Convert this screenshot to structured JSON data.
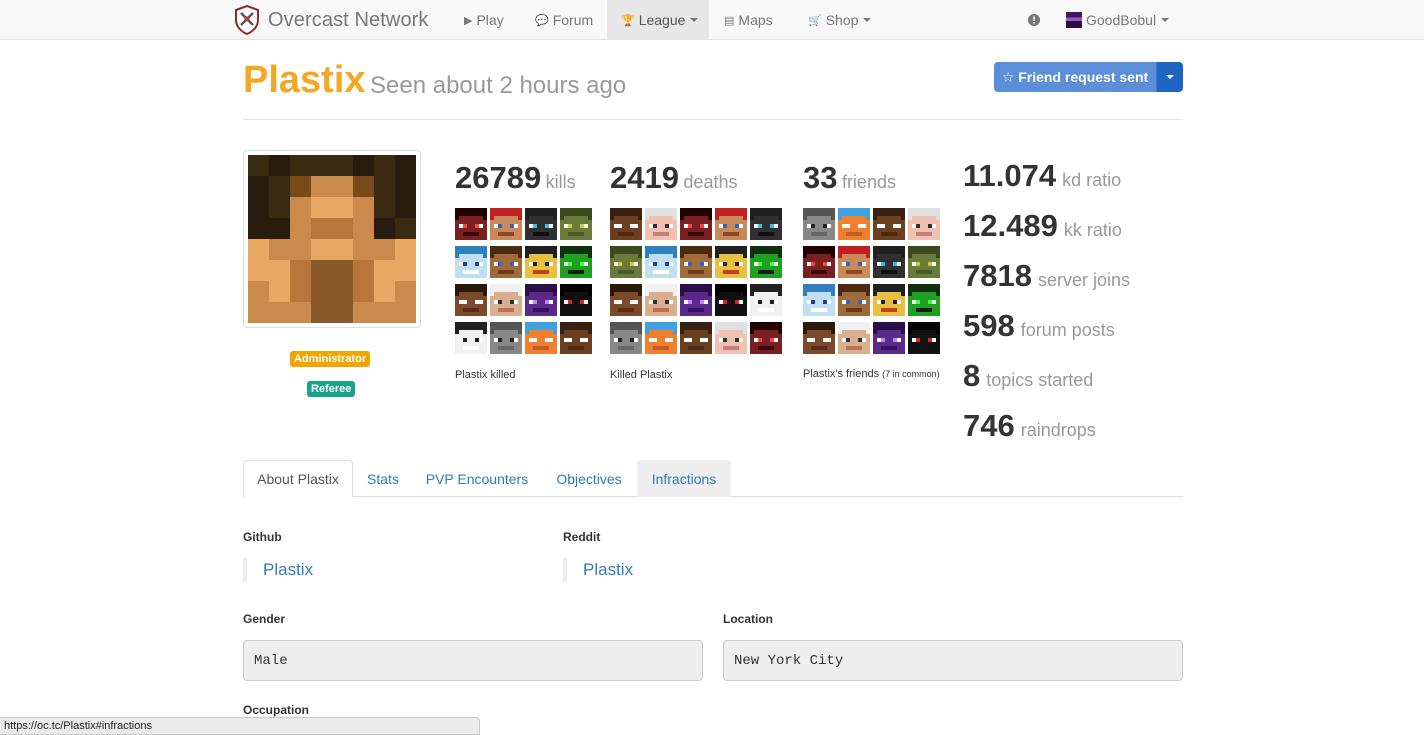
{
  "nav": {
    "brand": "Overcast Network",
    "items": [
      {
        "label": "Play",
        "icon": "play-icon"
      },
      {
        "label": "Forum",
        "icon": "comments-icon"
      },
      {
        "label": "League",
        "icon": "trophy-icon"
      },
      {
        "label": "Maps",
        "icon": "map-list-icon"
      },
      {
        "label": "Shop",
        "icon": "cart-icon"
      }
    ],
    "alert_icon": "exclamation-circle-icon",
    "user": "GoodBobul"
  },
  "profile": {
    "name": "Plastix",
    "seen": "Seen about 2 hours ago",
    "friend_button": "☆ Friend request sent",
    "badges": [
      "Administrator",
      "Referee"
    ]
  },
  "stats": {
    "kills": {
      "value": "26789",
      "label": "kills",
      "caption": "Plastix killed"
    },
    "deaths": {
      "value": "2419",
      "label": "deaths",
      "caption": "Killed Plastix"
    },
    "friends": {
      "value": "33",
      "label": "friends",
      "caption": "Plastix's friends",
      "caption_small": "(7 in common)"
    },
    "right": [
      {
        "value": "11.074",
        "label": "kd ratio"
      },
      {
        "value": "12.489",
        "label": "kk ratio"
      },
      {
        "value": "7818",
        "label": "server joins"
      },
      {
        "value": "598",
        "label": "forum posts"
      },
      {
        "value": "8",
        "label": "topics started"
      },
      {
        "value": "746",
        "label": "raindrops"
      }
    ]
  },
  "tabs": [
    "About Plastix",
    "Stats",
    "PVP Encounters",
    "Objectives",
    "Infractions"
  ],
  "about": {
    "github_label": "Github",
    "github_value": "Plastix",
    "reddit_label": "Reddit",
    "reddit_value": "Plastix",
    "gender_label": "Gender",
    "gender_value": "Male",
    "location_label": "Location",
    "location_value": "New York City",
    "occupation_label": "Occupation"
  },
  "status_url": "https://oc.tc/Plastix#infractions"
}
